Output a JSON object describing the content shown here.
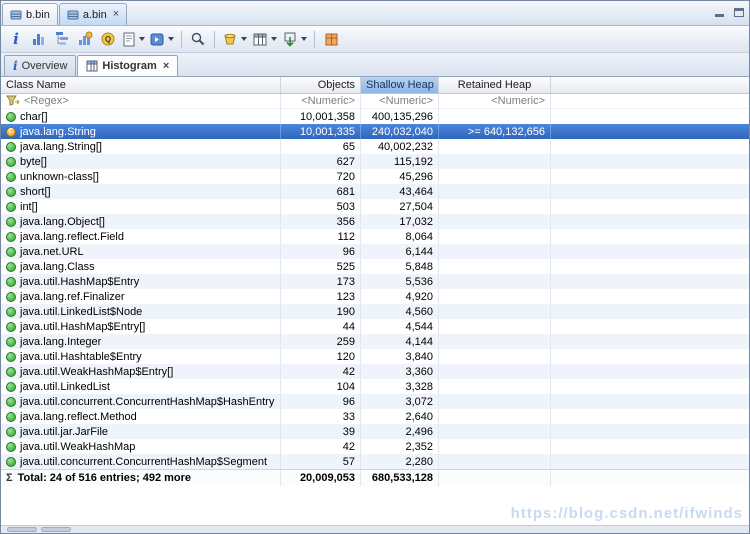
{
  "colors": {
    "selection": "#4c86dc",
    "selection_bottom": "#2f66bd",
    "sorted_header": "#8db4e8",
    "sorted_header_top": "#b9d2f1",
    "alt_row": "#eff4fb",
    "watermark": "#c8daf0"
  },
  "editor_tabs": [
    {
      "label": "b.bin"
    },
    {
      "label": "a.bin"
    }
  ],
  "toolbar": {
    "buttons": [
      {
        "name": "overview"
      },
      {
        "name": "create-histogram"
      },
      {
        "name": "dominator-tree"
      },
      {
        "name": "top-consumers"
      },
      {
        "name": "oql"
      },
      {
        "name": "run-expert-report"
      },
      {
        "name": "query-browser"
      },
      {
        "name": "search"
      },
      {
        "name": "group-by"
      },
      {
        "name": "customize-table"
      },
      {
        "name": "export"
      },
      {
        "name": "compare"
      }
    ]
  },
  "view_tabs": [
    {
      "label": "Overview"
    },
    {
      "label": "Histogram"
    }
  ],
  "table": {
    "columns": {
      "class_name": "Class Name",
      "objects": "Objects",
      "shallow_heap": "Shallow Heap",
      "retained_heap": "Retained Heap"
    },
    "filter_row": {
      "class_name": "<Regex>",
      "objects": "<Numeric>",
      "shallow_heap": "<Numeric>",
      "retained_heap": "<Numeric>"
    },
    "selected_index": 1,
    "rows": [
      {
        "class_name": "char[]",
        "objects": "10,001,358",
        "shallow_heap": "400,135,296",
        "retained_heap": ""
      },
      {
        "class_name": "java.lang.String",
        "objects": "10,001,335",
        "shallow_heap": "240,032,040",
        "retained_heap": ">= 640,132,656"
      },
      {
        "class_name": "java.lang.String[]",
        "objects": "65",
        "shallow_heap": "40,002,232",
        "retained_heap": ""
      },
      {
        "class_name": "byte[]",
        "objects": "627",
        "shallow_heap": "115,192",
        "retained_heap": ""
      },
      {
        "class_name": "unknown-class[]",
        "objects": "720",
        "shallow_heap": "45,296",
        "retained_heap": ""
      },
      {
        "class_name": "short[]",
        "objects": "681",
        "shallow_heap": "43,464",
        "retained_heap": ""
      },
      {
        "class_name": "int[]",
        "objects": "503",
        "shallow_heap": "27,504",
        "retained_heap": ""
      },
      {
        "class_name": "java.lang.Object[]",
        "objects": "356",
        "shallow_heap": "17,032",
        "retained_heap": ""
      },
      {
        "class_name": "java.lang.reflect.Field",
        "objects": "112",
        "shallow_heap": "8,064",
        "retained_heap": ""
      },
      {
        "class_name": "java.net.URL",
        "objects": "96",
        "shallow_heap": "6,144",
        "retained_heap": ""
      },
      {
        "class_name": "java.lang.Class",
        "objects": "525",
        "shallow_heap": "5,848",
        "retained_heap": ""
      },
      {
        "class_name": "java.util.HashMap$Entry",
        "objects": "173",
        "shallow_heap": "5,536",
        "retained_heap": ""
      },
      {
        "class_name": "java.lang.ref.Finalizer",
        "objects": "123",
        "shallow_heap": "4,920",
        "retained_heap": ""
      },
      {
        "class_name": "java.util.LinkedList$Node",
        "objects": "190",
        "shallow_heap": "4,560",
        "retained_heap": ""
      },
      {
        "class_name": "java.util.HashMap$Entry[]",
        "objects": "44",
        "shallow_heap": "4,544",
        "retained_heap": ""
      },
      {
        "class_name": "java.lang.Integer",
        "objects": "259",
        "shallow_heap": "4,144",
        "retained_heap": ""
      },
      {
        "class_name": "java.util.Hashtable$Entry",
        "objects": "120",
        "shallow_heap": "3,840",
        "retained_heap": ""
      },
      {
        "class_name": "java.util.WeakHashMap$Entry[]",
        "objects": "42",
        "shallow_heap": "3,360",
        "retained_heap": ""
      },
      {
        "class_name": "java.util.LinkedList",
        "objects": "104",
        "shallow_heap": "3,328",
        "retained_heap": ""
      },
      {
        "class_name": "java.util.concurrent.ConcurrentHashMap$HashEntry",
        "objects": "96",
        "shallow_heap": "3,072",
        "retained_heap": ""
      },
      {
        "class_name": "java.lang.reflect.Method",
        "objects": "33",
        "shallow_heap": "2,640",
        "retained_heap": ""
      },
      {
        "class_name": "java.util.jar.JarFile",
        "objects": "39",
        "shallow_heap": "2,496",
        "retained_heap": ""
      },
      {
        "class_name": "java.util.WeakHashMap",
        "objects": "42",
        "shallow_heap": "2,352",
        "retained_heap": ""
      },
      {
        "class_name": "java.util.concurrent.ConcurrentHashMap$Segment",
        "objects": "57",
        "shallow_heap": "2,280",
        "retained_heap": ""
      }
    ],
    "total_row": {
      "class_name": "Total: 24 of 516 entries; 492 more",
      "objects": "20,009,053",
      "shallow_heap": "680,533,128",
      "retained_heap": ""
    }
  },
  "watermark": "https://blog.csdn.net/ifwinds"
}
